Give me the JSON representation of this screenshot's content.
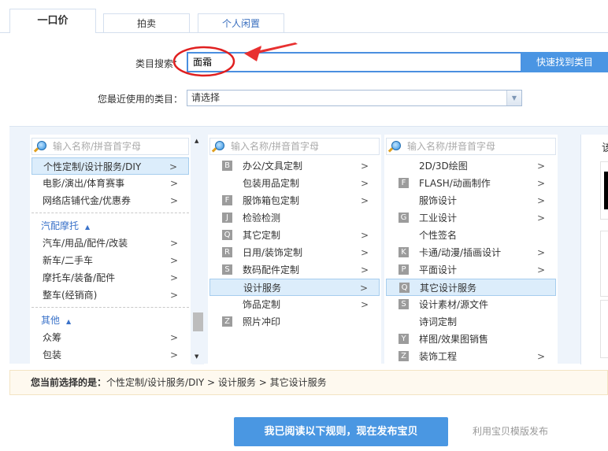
{
  "tabs": [
    {
      "label": "一口价",
      "active": true
    },
    {
      "label": "拍卖"
    },
    {
      "label": "个人闲置"
    }
  ],
  "search": {
    "label": "类目搜索：",
    "value": "面霜",
    "button": "快速找到类目"
  },
  "recent": {
    "label": "您最近使用的类目：",
    "value": "请选择"
  },
  "placeholder": "输入名称/拼音首字母",
  "col1": {
    "items": [
      "个性定制/设计服务/DIY",
      "电影/演出/体育赛事",
      "网络店铺代金/优惠券"
    ],
    "group1": "汽配摩托",
    "group1_items": [
      "汽车/用品/配件/改装",
      "新车/二手车",
      "摩托车/装备/配件",
      "整车(经销商)"
    ],
    "group2": "其他",
    "group2_items": [
      "众筹",
      "包装"
    ]
  },
  "col2": {
    "items": [
      {
        "l": "B",
        "t": "办公/文具定制",
        "c": true
      },
      {
        "l": "",
        "t": "包装用品定制",
        "c": true
      },
      {
        "l": "F",
        "t": "服饰箱包定制",
        "c": true
      },
      {
        "l": "J",
        "t": "检验检测",
        "c": false
      },
      {
        "l": "Q",
        "t": "其它定制",
        "c": true
      },
      {
        "l": "R",
        "t": "日用/装饰定制",
        "c": true
      },
      {
        "l": "S",
        "t": "数码配件定制",
        "c": true
      },
      {
        "l": "",
        "t": "设计服务",
        "c": true,
        "sel": true
      },
      {
        "l": "",
        "t": "饰品定制",
        "c": true
      },
      {
        "l": "Z",
        "t": "照片冲印",
        "c": false
      }
    ]
  },
  "col3": {
    "items": [
      {
        "l": "",
        "t": "2D/3D绘图",
        "c": true
      },
      {
        "l": "F",
        "t": "FLASH/动画制作",
        "c": true
      },
      {
        "l": "",
        "t": "服饰设计",
        "c": true
      },
      {
        "l": "G",
        "t": "工业设计",
        "c": true
      },
      {
        "l": "",
        "t": "个性签名",
        "c": false
      },
      {
        "l": "K",
        "t": "卡通/动漫/插画设计",
        "c": true
      },
      {
        "l": "P",
        "t": "平面设计",
        "c": true
      },
      {
        "l": "Q",
        "t": "其它设计服务",
        "c": false,
        "sel": true
      },
      {
        "l": "S",
        "t": "设计素材/源文件",
        "c": false
      },
      {
        "l": "",
        "t": "诗词定制",
        "c": false
      },
      {
        "l": "Y",
        "t": "样图/效果图销售",
        "c": false
      },
      {
        "l": "Z",
        "t": "装饰工程",
        "c": true
      }
    ]
  },
  "right_panel_text": "该",
  "crumb": {
    "label": "您当前选择的是：",
    "path": "个性定制/设计服务/DIY > 设计服务 > 其它设计服务"
  },
  "publish_button": "我已阅读以下规则，现在发布宝贝",
  "template_link": "利用宝贝模版发布",
  "colors": {
    "accent": "#4a97e2",
    "annotation": "#e02020"
  }
}
